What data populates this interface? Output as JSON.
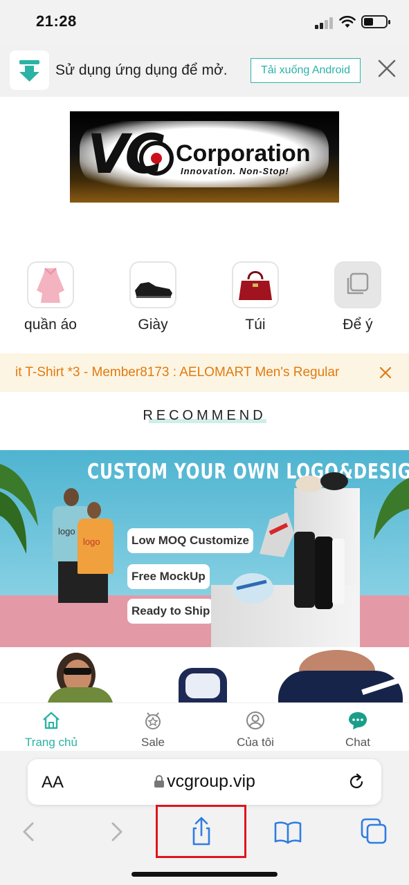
{
  "status_bar": {
    "time": "21:28"
  },
  "app_banner": {
    "text": "Sử dụng ứng dụng để mở.",
    "download_label": "Tải xuống Android"
  },
  "logo": {
    "brand_vc": "VC",
    "brand_name": "Corporation",
    "tagline": "Innovation. Non-Stop!"
  },
  "categories": [
    {
      "label": "quần áo",
      "icon": "dress-icon"
    },
    {
      "label": "Giày",
      "icon": "shoe-icon"
    },
    {
      "label": "Túi",
      "icon": "handbag-icon"
    },
    {
      "label": "Để ý",
      "icon": "copy-icon"
    }
  ],
  "marquee": {
    "text": "it T-Shirt *3 - Member8173 : AELOMART Men's Regular"
  },
  "recommend": {
    "heading": "RECOMMEND"
  },
  "promo": {
    "title": "CUSTOM YOUR OWN LOGO&DESIGN",
    "pills": [
      "Low MOQ Customize",
      "Free MockUp",
      "Ready to Ship"
    ],
    "logo_text": "logo"
  },
  "bottom_nav": {
    "items": [
      {
        "label": "Trang chủ",
        "icon": "home-icon",
        "active": true
      },
      {
        "label": "Sale",
        "icon": "sale-badge-icon",
        "active": false
      },
      {
        "label": "Của tôi",
        "icon": "profile-icon",
        "active": false
      },
      {
        "label": "Chat",
        "icon": "chat-icon",
        "active": false
      }
    ]
  },
  "safari": {
    "aa_label": "AA",
    "url": "vcgroup.vip"
  },
  "colors": {
    "accent": "#2bb3a5",
    "marquee_text": "#e07a10",
    "highlight": "#e0141c"
  }
}
